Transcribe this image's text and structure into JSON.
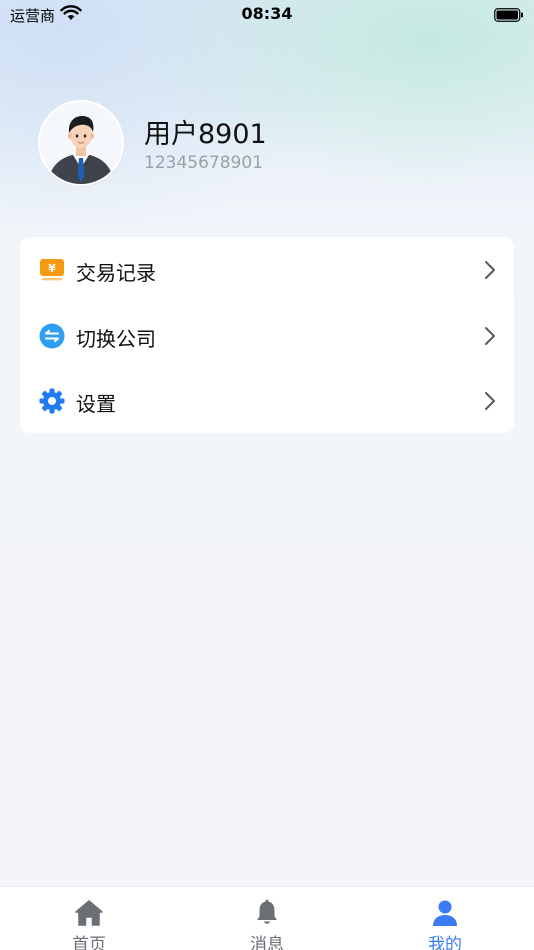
{
  "status_bar": {
    "carrier": "运营商",
    "time": "08:34"
  },
  "profile": {
    "name": "用户8901",
    "phone": "12345678901"
  },
  "menu": {
    "items": [
      {
        "label": "交易记录",
        "icon": "yuan-receipt-icon"
      },
      {
        "label": "切换公司",
        "icon": "switch-arrows-icon"
      },
      {
        "label": "设置",
        "icon": "gear-icon"
      }
    ]
  },
  "tab_bar": {
    "tabs": [
      {
        "label": "首页",
        "icon": "home-icon",
        "active": false
      },
      {
        "label": "消息",
        "icon": "bell-icon",
        "active": false
      },
      {
        "label": "我的",
        "icon": "person-icon",
        "active": true
      }
    ]
  },
  "colors": {
    "accent": "#3b7cf5",
    "tab_inactive": "#6b6f76",
    "receipt_orange": "#f59a12",
    "switch_blue": "#2e9ff0",
    "gear_blue": "#1f7bf2"
  }
}
